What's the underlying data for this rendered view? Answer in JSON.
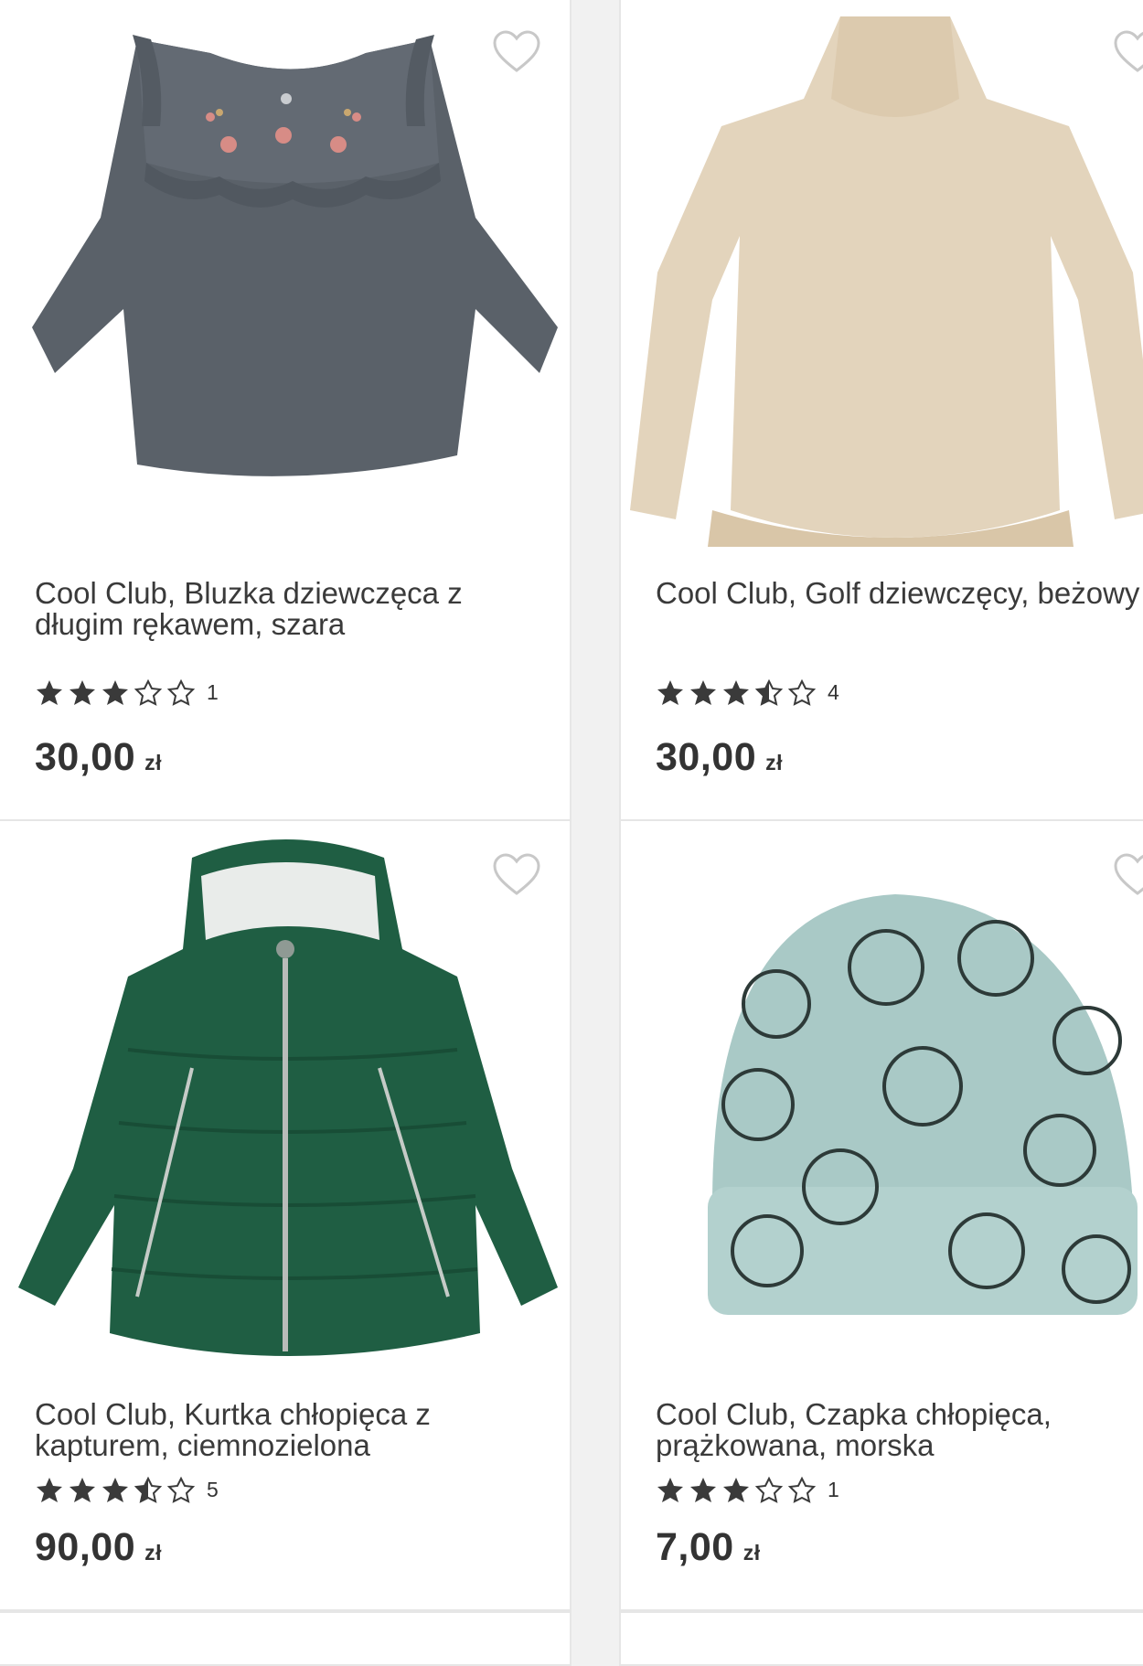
{
  "products": [
    {
      "brand": "Cool Club",
      "title": "Cool Club, Bluzka dziewczęca z\ndługim rękawem, szara",
      "rating": 3,
      "review_count": "1",
      "price": "30,00",
      "currency": "zł",
      "image": "grey-blouse-image"
    },
    {
      "brand": "Cool Club",
      "title": "Cool Club, Golf dziewczęcy, beżowy",
      "rating": 3.5,
      "review_count": "4",
      "price": "30,00",
      "currency": "zł",
      "image": "beige-turtleneck-image"
    },
    {
      "brand": "Cool Club",
      "title": "Cool Club, Kurtka chłopięca z\nkapturem, ciemnozielona",
      "rating": 3.5,
      "review_count": "5",
      "price": "90,00",
      "currency": "zł",
      "image": "green-jacket-image"
    },
    {
      "brand": "Cool Club",
      "title": "Cool Club, Czapka chłopięca,\nprążkowana, morska",
      "rating": 3,
      "review_count": "1",
      "price": "7,00",
      "currency": "zł",
      "image": "mint-beanie-image"
    }
  ],
  "colors": {
    "star": "#3a3a3a",
    "text": "#333333",
    "border": "#e6e6e6"
  },
  "icons": {
    "favorite": "heart-outline-icon",
    "star_full": "star-filled-icon",
    "star_empty": "star-outline-icon",
    "star_half": "star-half-icon"
  }
}
